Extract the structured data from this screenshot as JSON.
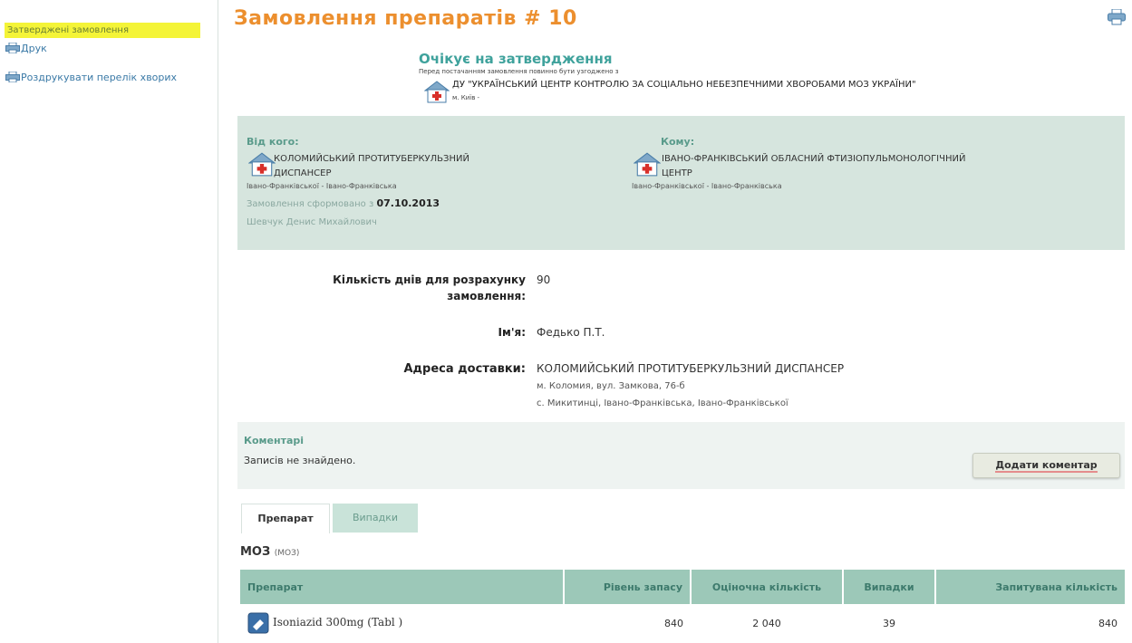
{
  "sidebar": {
    "active": "Затверджені замовлення",
    "print": "Друк",
    "print_list": "Роздрукувати перелік хворих"
  },
  "header": {
    "title": "Замовлення препаратів # 10"
  },
  "status": {
    "title": "Очікує на затвердження",
    "note": "Перед постачанням замовлення повинно бути узгоджено з",
    "org": "ДУ \"УКРАЇНСЬКИЙ ЦЕНТР КОНТРОЛЮ ЗА СОЦІАЛЬНО НЕБЕЗПЕЧНИМИ ХВОРОБАМИ МОЗ УКРАЇНИ\"",
    "city": "м. Київ -"
  },
  "from": {
    "label": "Від кого:",
    "org_line1": "КОЛОМИЙСЬКИЙ ПРОТИТУБЕРКУЛЬЗНИЙ",
    "org_line2": "ДИСПАНСЕР",
    "region": "Івано-Франківської - Івано-Франківська",
    "formed_label": "Замовлення сформовано з",
    "formed_date": "07.10.2013",
    "author": "Шевчук Денис Михайлович"
  },
  "to": {
    "label": "Кому:",
    "org_line1": "ІВАНО-ФРАНКІВСЬКИЙ ОБЛАСНИЙ ФТИЗІОПУЛЬМОНОЛОГІЧНИЙ",
    "org_line2": "ЦЕНТР",
    "region": "Івано-Франківської - Івано-Франківська"
  },
  "fields": {
    "days_label1": "Кількість днів для розрахунку",
    "days_label2": "замовлення:",
    "days_value": "90",
    "name_label": "Ім'я:",
    "name_value": "Федько П.Т.",
    "address_label": "Адреса доставки:",
    "address_line1": "КОЛОМИЙСЬКИЙ ПРОТИТУБЕРКУЛЬЗНИЙ ДИСПАНСЕР",
    "address_line2": "м. Коломия, вул. Замкова, 76-б",
    "address_line3": "с. Микитинці, Івано-Франківська, Івано-Франківської"
  },
  "comments": {
    "title": "Коментарі",
    "empty": "Записів не знайдено.",
    "add_button": "Додати коментар"
  },
  "tabs": [
    {
      "label": "Препарат"
    },
    {
      "label": "Випадки"
    }
  ],
  "section": {
    "title": "МОЗ",
    "sub": "(МОЗ)"
  },
  "table": {
    "headers": [
      "Препарат",
      "Рівень запасу",
      "Оціночна кількість",
      "Випадки",
      "Запитувана кількість"
    ],
    "rows": [
      {
        "drug": "Isoniazid 300mg (Tabl )",
        "stock": "840",
        "estimate": "2 040",
        "cases": "39",
        "requested": "840"
      }
    ]
  },
  "colors": {
    "accent": "#ec8f2e",
    "teal": "#3fa29c",
    "panel": "#d6e5de",
    "header": "#9cc8b8",
    "highlight": "#f4f437"
  }
}
